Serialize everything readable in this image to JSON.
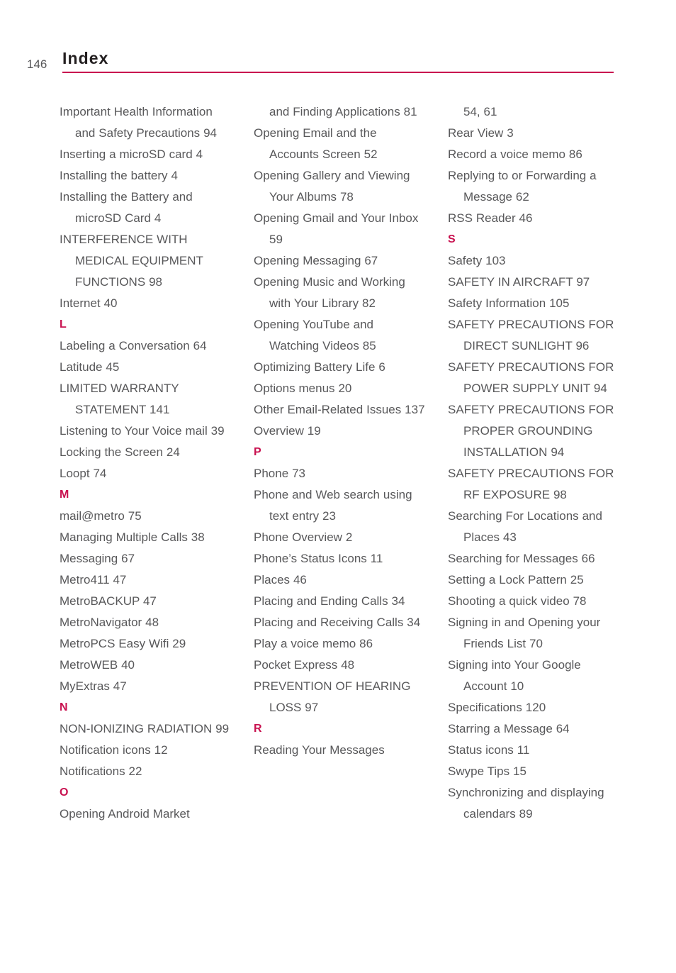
{
  "document": {
    "page_number": "146",
    "title": "Index",
    "accent_color": "#c8114f",
    "text_color": "#58585a"
  },
  "columns": [
    {
      "name": "column-1",
      "blocks": [
        {
          "type": "entry",
          "text": "Important Health Information and Safety Precautions 94"
        },
        {
          "type": "entry",
          "text": "Inserting a microSD card 4"
        },
        {
          "type": "entry",
          "text": "Installing the battery 4"
        },
        {
          "type": "entry",
          "text": "Installing the Battery and microSD Card 4"
        },
        {
          "type": "entry",
          "text": "INTERFERENCE WITH MEDICAL EQUIPMENT FUNCTIONS 98"
        },
        {
          "type": "entry",
          "text": "Internet 40"
        },
        {
          "type": "letter",
          "text": "L"
        },
        {
          "type": "entry",
          "text": "Labeling a Conversation 64"
        },
        {
          "type": "entry",
          "text": "Latitude 45"
        },
        {
          "type": "entry",
          "text": "LIMITED WARRANTY STATEMENT 141"
        },
        {
          "type": "entry",
          "text": "Listening to Your Voice mail 39"
        },
        {
          "type": "entry",
          "text": "Locking the Screen 24"
        },
        {
          "type": "entry",
          "text": "Loopt 74"
        },
        {
          "type": "letter",
          "text": "M"
        },
        {
          "type": "entry",
          "text": "mail@metro 75"
        },
        {
          "type": "entry",
          "text": "Managing Multiple Calls 38"
        },
        {
          "type": "entry",
          "text": "Messaging 67"
        },
        {
          "type": "entry",
          "text": "Metro411 47"
        },
        {
          "type": "entry",
          "text": "MetroBACKUP 47"
        },
        {
          "type": "entry",
          "text": "MetroNavigator 48"
        },
        {
          "type": "entry",
          "text": "MetroPCS Easy Wifi 29"
        },
        {
          "type": "entry",
          "text": "MetroWEB 40"
        },
        {
          "type": "entry",
          "text": "MyExtras 47"
        },
        {
          "type": "letter",
          "text": "N"
        },
        {
          "type": "entry",
          "text": "NON-IONIZING RADIATION 99"
        },
        {
          "type": "entry",
          "text": "Notification icons 12"
        },
        {
          "type": "entry",
          "text": "Notifications 22"
        },
        {
          "type": "letter",
          "text": "O"
        },
        {
          "type": "entry",
          "text": "Opening Android Market"
        }
      ]
    },
    {
      "name": "column-2",
      "blocks": [
        {
          "type": "entry",
          "text": "and Finding Applications 81",
          "continuation": true
        },
        {
          "type": "entry",
          "text": "Opening Email and the Accounts Screen 52"
        },
        {
          "type": "entry",
          "text": "Opening Gallery and Viewing Your Albums 78"
        },
        {
          "type": "entry",
          "text": "Opening Gmail and Your Inbox 59"
        },
        {
          "type": "entry",
          "text": "Opening Messaging 67"
        },
        {
          "type": "entry",
          "text": "Opening Music and Working with Your Library 82"
        },
        {
          "type": "entry",
          "text": "Opening YouTube and Watching Videos 85"
        },
        {
          "type": "entry",
          "text": "Optimizing Battery Life 6"
        },
        {
          "type": "entry",
          "text": "Options menus 20"
        },
        {
          "type": "entry",
          "text": "Other Email-Related Issues 137"
        },
        {
          "type": "entry",
          "text": "Overview 19"
        },
        {
          "type": "letter",
          "text": "P"
        },
        {
          "type": "entry",
          "text": "Phone 73"
        },
        {
          "type": "entry",
          "text": "Phone and Web search using text entry 23"
        },
        {
          "type": "entry",
          "text": "Phone Overview 2"
        },
        {
          "type": "entry",
          "text": "Phone’s Status Icons 11"
        },
        {
          "type": "entry",
          "text": "Places 46"
        },
        {
          "type": "entry",
          "text": "Placing and Ending Calls 34"
        },
        {
          "type": "entry",
          "text": "Placing and Receiving Calls 34"
        },
        {
          "type": "entry",
          "text": "Play a voice memo 86"
        },
        {
          "type": "entry",
          "text": "Pocket Express 48"
        },
        {
          "type": "entry",
          "text": "PREVENTION OF HEARING LOSS 97"
        },
        {
          "type": "letter",
          "text": "R"
        },
        {
          "type": "entry",
          "text": "Reading Your Messages"
        }
      ]
    },
    {
      "name": "column-3",
      "blocks": [
        {
          "type": "entry",
          "text": "54, 61",
          "continuation": true
        },
        {
          "type": "entry",
          "text": "Rear View 3"
        },
        {
          "type": "entry",
          "text": "Record a voice memo 86"
        },
        {
          "type": "entry",
          "text": "Replying to or Forwarding a Message 62"
        },
        {
          "type": "entry",
          "text": "RSS Reader 46"
        },
        {
          "type": "letter",
          "text": "S"
        },
        {
          "type": "entry",
          "text": "Safety 103"
        },
        {
          "type": "entry",
          "text": "SAFETY IN AIRCRAFT 97"
        },
        {
          "type": "entry",
          "text": "Safety Information 105"
        },
        {
          "type": "entry",
          "text": "SAFETY PRECAUTIONS FOR DIRECT SUNLIGHT 96"
        },
        {
          "type": "entry",
          "text": "SAFETY PRECAUTIONS FOR POWER SUPPLY UNIT 94"
        },
        {
          "type": "entry",
          "text": "SAFETY PRECAUTIONS FOR PROPER GROUNDING INSTALLATION 94"
        },
        {
          "type": "entry",
          "text": "SAFETY PRECAUTIONS FOR RF EXPOSURE 98"
        },
        {
          "type": "entry",
          "text": "Searching For Locations and Places 43"
        },
        {
          "type": "entry",
          "text": "Searching for Messages 66"
        },
        {
          "type": "entry",
          "text": "Setting a Lock Pattern 25"
        },
        {
          "type": "entry",
          "text": "Shooting a quick video 78"
        },
        {
          "type": "entry",
          "text": "Signing in and Opening your Friends List 70"
        },
        {
          "type": "entry",
          "text": "Signing into Your Google Account 10"
        },
        {
          "type": "entry",
          "text": "Specifications 120"
        },
        {
          "type": "entry",
          "text": "Starring a Message 64"
        },
        {
          "type": "entry",
          "text": "Status icons 11"
        },
        {
          "type": "entry",
          "text": "Swype Tips 15"
        },
        {
          "type": "entry",
          "text": "Synchronizing and displaying calendars 89"
        }
      ]
    }
  ]
}
